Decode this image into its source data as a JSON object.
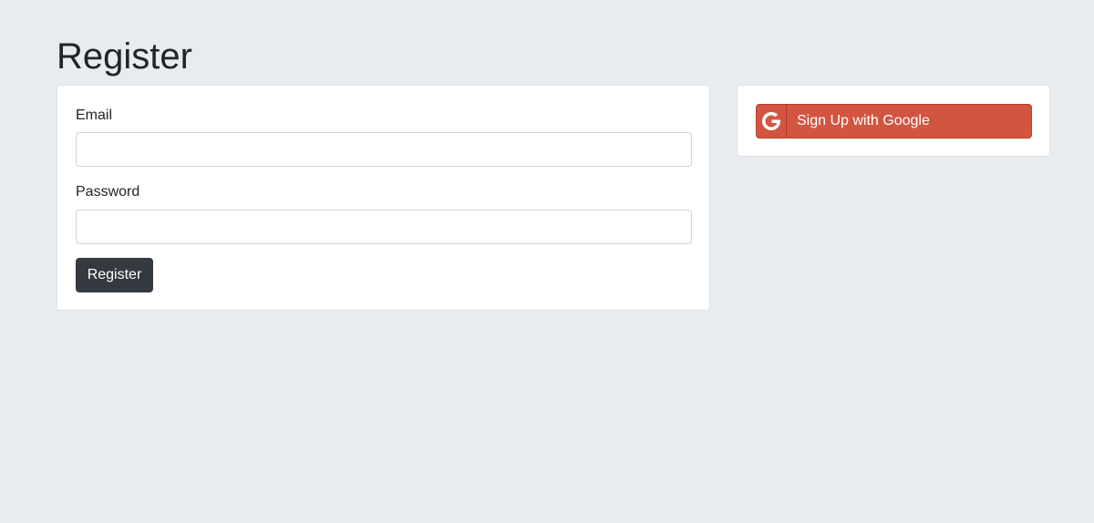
{
  "page": {
    "title": "Register"
  },
  "form": {
    "email_label": "Email",
    "email_value": "",
    "password_label": "Password",
    "password_value": "",
    "submit_label": "Register"
  },
  "social": {
    "google_label": "Sign Up with Google",
    "google_icon": "google-g-icon"
  },
  "colors": {
    "background": "#e9ecef",
    "card": "#ffffff",
    "primary_button": "#343a40",
    "google_button": "#d25542"
  }
}
